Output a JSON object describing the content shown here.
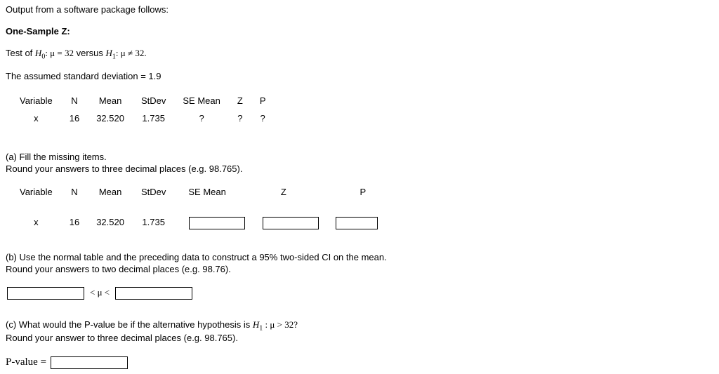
{
  "intro": "Output from a software package follows:",
  "title": "One-Sample Z:",
  "hypothesis": {
    "prefix": "Test of ",
    "h0_label": "H",
    "h0_sub": "0",
    "h0_text": ": μ = 32",
    "versus": " versus ",
    "h1_label": "H",
    "h1_sub": "1",
    "h1_text": ": μ ≠ 32."
  },
  "assumed": "The assumed standard deviation = 1.9",
  "table1": {
    "headers": [
      "Variable",
      "N",
      "Mean",
      "StDev",
      "SE Mean",
      "Z",
      "P"
    ],
    "row": [
      "x",
      "16",
      "32.520",
      "1.735",
      "?",
      "?",
      "?"
    ]
  },
  "part_a": {
    "line1": "(a) Fill the missing items.",
    "line2": "Round your answers to three decimal places (e.g. 98.765).",
    "headers": [
      "Variable",
      "N",
      "Mean",
      "StDev",
      "SE Mean",
      "Z",
      "P"
    ],
    "row": [
      "x",
      "16",
      "32.520",
      "1.735"
    ]
  },
  "part_b": {
    "line1": "(b) Use the normal table and the preceding data to construct a 95% two-sided CI on the mean.",
    "line2": "Round your answers to two decimal places (e.g. 98.76).",
    "mid": "< μ <"
  },
  "part_c": {
    "line_prefix": "(c) What would the P-value be if the alternative hypothesis is ",
    "h1_label": "H",
    "h1_sub": "1",
    "h1_text": " : μ > 32?",
    "line2": "Round your answer to three decimal places (e.g. 98.765).",
    "pval_label": "P-value ="
  }
}
